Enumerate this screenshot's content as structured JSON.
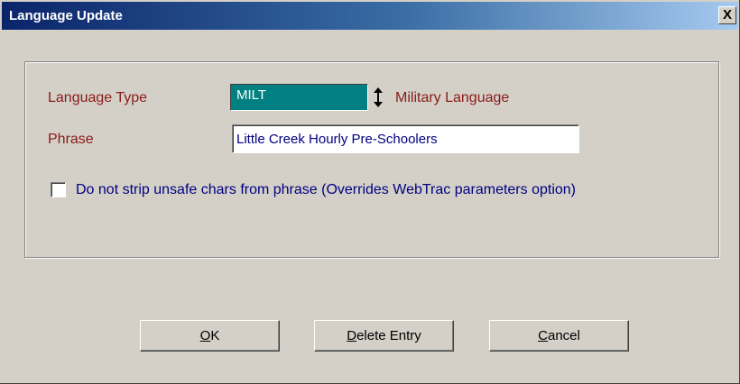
{
  "window": {
    "title": "Language Update",
    "close_label": "X"
  },
  "form": {
    "language_type_label": "Language Type",
    "language_type_value": "MILT",
    "language_type_description": "Military Language",
    "phrase_label": "Phrase",
    "phrase_value": "Little Creek Hourly Pre-Schoolers",
    "checkbox_label": "Do not strip unsafe chars from phrase (Overrides WebTrac parameters option)",
    "checkbox_checked": false
  },
  "buttons": {
    "ok": {
      "mnemonic": "O",
      "rest": "K"
    },
    "delete": {
      "mnemonic": "D",
      "rest": "elete Entry"
    },
    "cancel": {
      "mnemonic": "C",
      "rest": "ancel"
    }
  },
  "icons": {
    "updown": "updown-arrow-icon",
    "close": "close-icon"
  }
}
